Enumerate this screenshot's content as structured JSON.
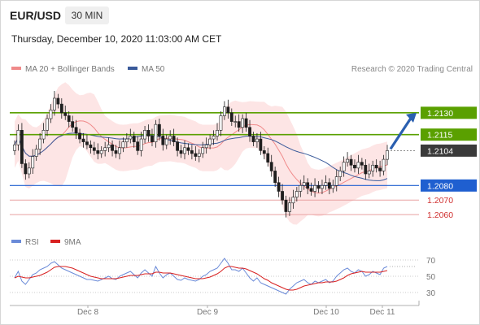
{
  "header": {
    "pair": "EUR/USD",
    "timeframe": "30 MIN",
    "datetime": "Thursday, December 10, 2020 11:03:00 AM CET"
  },
  "legend": {
    "ma20_label": "MA 20 + Bollinger Bands",
    "ma50_label": "MA 50",
    "credit": "Research © 2020 Trading Central"
  },
  "rsi_legend": {
    "rsi_label": "RSI",
    "ma9_label": "9MA"
  },
  "colors": {
    "resistance": "#5aa000",
    "support": "#1f5fd0",
    "support_extra": "#e8a0a0",
    "price": "#3a3a3a",
    "candle": "#1e1e1e",
    "bollinger_fill": "#fde0e0",
    "ma20": "#f08a8a",
    "ma50": "#3a5a9a",
    "rsi": "#6a8ad8",
    "ma9": "#d82020",
    "arrow": "#2a5fb0"
  },
  "chart_data": [
    {
      "type": "candlestick",
      "title": "EUR/USD 30 MIN",
      "x_ticks": [
        "Dec 8",
        "Dec 9",
        "Dec 10",
        "Dec 11"
      ],
      "ylim": [
        1.205,
        1.2145
      ],
      "levels": [
        {
          "value": 1.213,
          "label": "1.2130",
          "kind": "resistance"
        },
        {
          "value": 1.2115,
          "label": "1.2115",
          "kind": "resistance"
        },
        {
          "value": 1.2104,
          "label": "1.2104",
          "kind": "price"
        },
        {
          "value": 1.208,
          "label": "1.2080",
          "kind": "support"
        },
        {
          "value": 1.207,
          "label": "1.2070",
          "kind": "support_extra"
        },
        {
          "value": 1.206,
          "label": "1.2060",
          "kind": "support_extra"
        }
      ],
      "series": [
        {
          "name": "MA 20 + Bollinger Bands"
        },
        {
          "name": "MA 50"
        }
      ],
      "close": [
        1.2108,
        1.2118,
        1.2095,
        1.2088,
        1.2092,
        1.21,
        1.2105,
        1.2112,
        1.2118,
        1.2126,
        1.2132,
        1.214,
        1.2136,
        1.213,
        1.2128,
        1.2124,
        1.212,
        1.2116,
        1.2112,
        1.211,
        1.2108,
        1.2106,
        1.2104,
        1.2102,
        1.2104,
        1.2106,
        1.2108,
        1.2104,
        1.2102,
        1.2106,
        1.211,
        1.2112,
        1.2114,
        1.211,
        1.2104,
        1.2112,
        1.2118,
        1.2114,
        1.211,
        1.2122,
        1.2114,
        1.2108,
        1.2112,
        1.2114,
        1.211,
        1.2104,
        1.2102,
        1.2106,
        1.2104,
        1.2102,
        1.21,
        1.2102,
        1.2106,
        1.2108,
        1.2112,
        1.2114,
        1.2118,
        1.2128,
        1.2134,
        1.213,
        1.2124,
        1.2124,
        1.212,
        1.2126,
        1.212,
        1.2114,
        1.211,
        1.2112,
        1.2104,
        1.2102,
        1.2096,
        1.209,
        1.2082,
        1.2076,
        1.207,
        1.2062,
        1.2068,
        1.2072,
        1.2076,
        1.208,
        1.2082,
        1.2078,
        1.2076,
        1.208,
        1.2078,
        1.208,
        1.2082,
        1.2078,
        1.208,
        1.2086,
        1.209,
        1.2096,
        1.2098,
        1.2094,
        1.2092,
        1.2096,
        1.2094,
        1.2088,
        1.209,
        1.2094,
        1.2092,
        1.209,
        1.2098,
        1.2104
      ],
      "rsi_ylim": [
        20,
        80
      ],
      "rsi_ticks": [
        70,
        50,
        30
      ],
      "rsi": [
        48,
        56,
        44,
        40,
        46,
        52,
        54,
        58,
        60,
        62,
        66,
        68,
        64,
        60,
        58,
        56,
        54,
        52,
        50,
        48,
        46,
        46,
        45,
        44,
        46,
        48,
        50,
        47,
        46,
        50,
        52,
        54,
        56,
        52,
        48,
        54,
        58,
        54,
        50,
        62,
        54,
        48,
        52,
        54,
        50,
        46,
        45,
        48,
        46,
        45,
        44,
        46,
        50,
        52,
        56,
        58,
        60,
        66,
        72,
        66,
        58,
        58,
        56,
        60,
        54,
        48,
        44,
        48,
        42,
        40,
        38,
        36,
        34,
        32,
        30,
        28,
        34,
        38,
        42,
        44,
        46,
        42,
        40,
        44,
        42,
        44,
        46,
        42,
        44,
        50,
        54,
        58,
        60,
        56,
        54,
        58,
        56,
        50,
        52,
        56,
        54,
        52,
        60,
        62
      ],
      "ma9": [
        48,
        50,
        49,
        48,
        48,
        49,
        50,
        51,
        53,
        55,
        58,
        61,
        62,
        62,
        62,
        61,
        60,
        58,
        56,
        54,
        52,
        50,
        49,
        48,
        47,
        47,
        47,
        47,
        47,
        48,
        49,
        50,
        51,
        51,
        51,
        52,
        53,
        53,
        53,
        55,
        55,
        54,
        54,
        54,
        53,
        52,
        51,
        50,
        49,
        48,
        47,
        47,
        47,
        48,
        49,
        51,
        53,
        56,
        60,
        62,
        62,
        61,
        60,
        60,
        59,
        57,
        55,
        53,
        50,
        47,
        45,
        42,
        40,
        38,
        36,
        34,
        33,
        33,
        34,
        36,
        38,
        39,
        40,
        41,
        42,
        42,
        43,
        43,
        43,
        44,
        46,
        48,
        51,
        53,
        54,
        55,
        56,
        55,
        55,
        55,
        55,
        55,
        56,
        57
      ]
    }
  ]
}
